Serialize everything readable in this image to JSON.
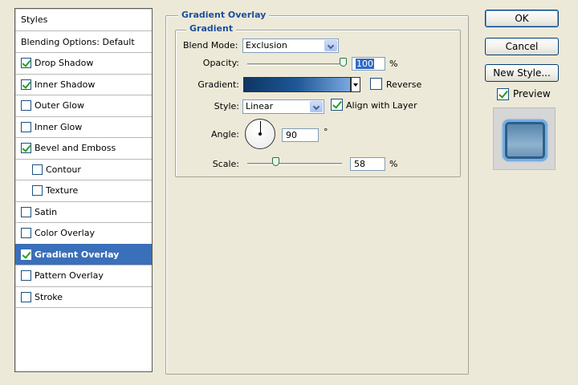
{
  "sidebar": {
    "header": "Styles",
    "items": [
      {
        "label": "Blending Options: Default",
        "checkbox": false,
        "checked": false,
        "indent": false,
        "selected": false
      },
      {
        "label": "Drop Shadow",
        "checkbox": true,
        "checked": true,
        "indent": false,
        "selected": false
      },
      {
        "label": "Inner Shadow",
        "checkbox": true,
        "checked": true,
        "indent": false,
        "selected": false
      },
      {
        "label": "Outer Glow",
        "checkbox": true,
        "checked": false,
        "indent": false,
        "selected": false
      },
      {
        "label": "Inner Glow",
        "checkbox": true,
        "checked": false,
        "indent": false,
        "selected": false
      },
      {
        "label": "Bevel and Emboss",
        "checkbox": true,
        "checked": true,
        "indent": false,
        "selected": false
      },
      {
        "label": "Contour",
        "checkbox": true,
        "checked": false,
        "indent": true,
        "selected": false
      },
      {
        "label": "Texture",
        "checkbox": true,
        "checked": false,
        "indent": true,
        "selected": false
      },
      {
        "label": "Satin",
        "checkbox": true,
        "checked": false,
        "indent": false,
        "selected": false
      },
      {
        "label": "Color Overlay",
        "checkbox": true,
        "checked": false,
        "indent": false,
        "selected": false
      },
      {
        "label": "Gradient Overlay",
        "checkbox": true,
        "checked": true,
        "indent": false,
        "selected": true
      },
      {
        "label": "Pattern Overlay",
        "checkbox": true,
        "checked": false,
        "indent": false,
        "selected": false
      },
      {
        "label": "Stroke",
        "checkbox": true,
        "checked": false,
        "indent": false,
        "selected": false
      }
    ]
  },
  "panel": {
    "title": "Gradient Overlay",
    "subtitle": "Gradient",
    "blend_mode_label": "Blend Mode:",
    "blend_mode_value": "Exclusion",
    "opacity_label": "Opacity:",
    "opacity_value": "100",
    "opacity_unit": "%",
    "opacity_fraction": 1.0,
    "gradient_label": "Gradient:",
    "gradient_colors": [
      "#0e3564",
      "#1e5895",
      "#7aa8e0"
    ],
    "reverse_label": "Reverse",
    "reverse_checked": false,
    "style_label": "Style:",
    "style_value": "Linear",
    "align_label": "Align with Layer",
    "align_checked": true,
    "angle_label": "Angle:",
    "angle_value": "90",
    "angle_unit": "°",
    "scale_label": "Scale:",
    "scale_value": "58",
    "scale_unit": "%"
  },
  "buttons": {
    "ok": "OK",
    "cancel": "Cancel",
    "new_style": "New Style...",
    "preview_label": "Preview",
    "preview_checked": true
  },
  "colors": {
    "accent": "#3a6fb9",
    "legend": "#1c4f9c",
    "background": "#ece9d8"
  }
}
